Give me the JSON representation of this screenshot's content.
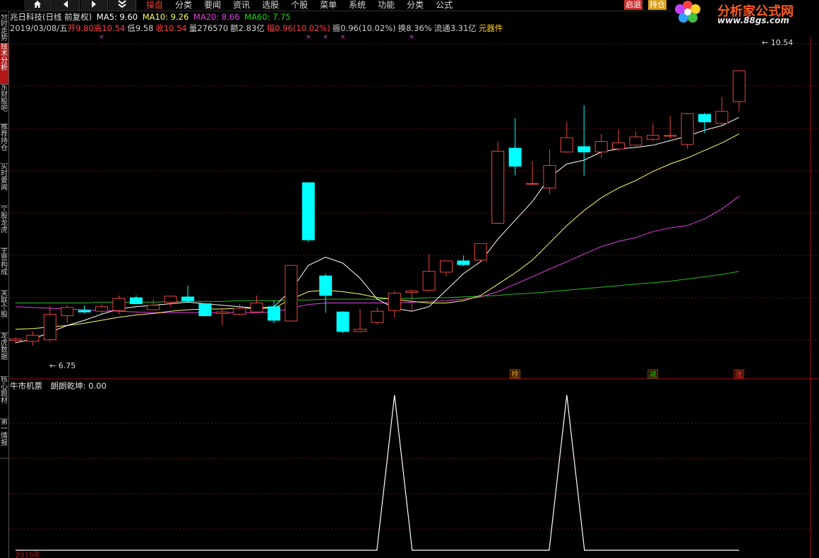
{
  "toolbar": {
    "nav_icons": [
      "home-icon",
      "back-arrow-icon",
      "forward-arrow-icon",
      "double-chevron-down-icon"
    ],
    "menu": [
      "操盘",
      "分类",
      "要闻",
      "资讯",
      "选股",
      "个股",
      "菜单",
      "系统",
      "功能",
      "分类",
      "公式"
    ],
    "active_menu": "操盘",
    "right_buttons": [
      "启退",
      "持仓"
    ]
  },
  "logo": {
    "text": "分析家公式网",
    "url": "www.88gs.com"
  },
  "sidebar": [
    "分时走势",
    "技术分析",
    "东财股吧",
    "推荐持仓",
    "实时要闻",
    "个股龙虎",
    "主营构成",
    "关联个股",
    "龙虎数据",
    "核心题材",
    "第一情报"
  ],
  "sidebar_active": "技术分析",
  "header": {
    "stock": "兆日科技(日线 前复权)",
    "ma5": "MA5: 9.60",
    "ma10": "MA10: 9.26",
    "ma20": "MA20: 8.66",
    "ma60": "MA60: 7.75",
    "date": "2019/03/08/五",
    "open": "开9.80",
    "high": "高10.54",
    "low": "低9.58",
    "close": "收10.54",
    "volume": "量276570",
    "amount": "额2.83亿",
    "change": "幅0.96(10.02%)",
    "amplitude": "振0.96(10.02%)",
    "turnover": "换8.36%",
    "float": "流通3.31亿",
    "sector": "元器件"
  },
  "colors": {
    "up": "#e8453c",
    "down": "#00ffff",
    "ma5": "#ffffff",
    "ma10": "#ffff60",
    "ma20": "#e040e0",
    "ma60": "#20c020",
    "grid": "#6b1010",
    "accent_red": "#ff3333",
    "indicator": "#ffffff"
  },
  "price_labels": {
    "max": "10.54",
    "min": "6.75"
  },
  "badges": [
    {
      "text": "榜",
      "color": "#d4a020",
      "bar": 29
    },
    {
      "text": "减",
      "color": "#20c020",
      "bar": 37
    },
    {
      "text": "涨",
      "color": "#ff3333",
      "bar": 42
    }
  ],
  "indicator_header": {
    "name": "牛市机票",
    "value": "朗朗乾坤: 0.00"
  },
  "bottom_axis": {
    "left": "2019年"
  },
  "chart_data": {
    "type": "candlestick",
    "price_range": [
      6.6,
      10.9
    ],
    "candles": [
      {
        "o": 6.95,
        "h": 6.99,
        "l": 6.91,
        "c": 6.97
      },
      {
        "o": 6.94,
        "h": 7.07,
        "l": 6.88,
        "c": 7.02
      },
      {
        "o": 6.96,
        "h": 7.41,
        "l": 6.94,
        "c": 7.3
      },
      {
        "o": 7.28,
        "h": 7.42,
        "l": 7.18,
        "c": 7.39
      },
      {
        "o": 7.35,
        "h": 7.42,
        "l": 7.31,
        "c": 7.33
      },
      {
        "o": 7.34,
        "h": 7.43,
        "l": 7.31,
        "c": 7.4
      },
      {
        "o": 7.35,
        "h": 7.55,
        "l": 7.3,
        "c": 7.51
      },
      {
        "o": 7.52,
        "h": 7.55,
        "l": 7.43,
        "c": 7.44
      },
      {
        "o": 7.36,
        "h": 7.5,
        "l": 7.35,
        "c": 7.42
      },
      {
        "o": 7.46,
        "h": 7.55,
        "l": 7.4,
        "c": 7.54
      },
      {
        "o": 7.53,
        "h": 7.68,
        "l": 7.45,
        "c": 7.48
      },
      {
        "o": 7.44,
        "h": 7.45,
        "l": 7.27,
        "c": 7.28
      },
      {
        "o": 7.31,
        "h": 7.38,
        "l": 7.15,
        "c": 7.33
      },
      {
        "o": 7.3,
        "h": 7.44,
        "l": 7.29,
        "c": 7.38
      },
      {
        "o": 7.33,
        "h": 7.55,
        "l": 7.33,
        "c": 7.45
      },
      {
        "o": 7.4,
        "h": 7.48,
        "l": 7.18,
        "c": 7.22
      },
      {
        "o": 7.21,
        "h": 7.95,
        "l": 7.2,
        "c": 7.95
      },
      {
        "o": 9.05,
        "h": 9.05,
        "l": 8.26,
        "c": 8.29
      },
      {
        "o": 7.81,
        "h": 7.84,
        "l": 7.32,
        "c": 7.55
      },
      {
        "o": 7.33,
        "h": 7.34,
        "l": 7.05,
        "c": 7.07
      },
      {
        "o": 7.07,
        "h": 7.37,
        "l": 7.06,
        "c": 7.1
      },
      {
        "o": 7.19,
        "h": 7.39,
        "l": 7.16,
        "c": 7.34
      },
      {
        "o": 7.35,
        "h": 7.61,
        "l": 7.26,
        "c": 7.58
      },
      {
        "o": 7.59,
        "h": 7.63,
        "l": 7.33,
        "c": 7.61
      },
      {
        "o": 7.62,
        "h": 8.1,
        "l": 7.6,
        "c": 7.87
      },
      {
        "o": 7.86,
        "h": 8.02,
        "l": 7.81,
        "c": 8.01
      },
      {
        "o": 8.01,
        "h": 8.08,
        "l": 7.94,
        "c": 7.96
      },
      {
        "o": 8.02,
        "h": 8.24,
        "l": 8.0,
        "c": 8.24
      },
      {
        "o": 8.51,
        "h": 9.6,
        "l": 8.5,
        "c": 9.47
      },
      {
        "o": 9.51,
        "h": 9.91,
        "l": 9.15,
        "c": 9.27
      },
      {
        "o": 9.04,
        "h": 9.34,
        "l": 9.02,
        "c": 9.04
      },
      {
        "o": 8.98,
        "h": 9.5,
        "l": 8.9,
        "c": 9.28
      },
      {
        "o": 9.46,
        "h": 9.86,
        "l": 9.45,
        "c": 9.65
      },
      {
        "o": 9.53,
        "h": 10.08,
        "l": 9.14,
        "c": 9.46
      },
      {
        "o": 9.46,
        "h": 9.7,
        "l": 9.38,
        "c": 9.6
      },
      {
        "o": 9.5,
        "h": 9.76,
        "l": 9.47,
        "c": 9.58
      },
      {
        "o": 9.55,
        "h": 9.73,
        "l": 9.52,
        "c": 9.66
      },
      {
        "o": 9.63,
        "h": 9.84,
        "l": 9.6,
        "c": 9.68
      },
      {
        "o": 9.67,
        "h": 9.94,
        "l": 9.64,
        "c": 9.68
      },
      {
        "o": 9.56,
        "h": 9.98,
        "l": 9.5,
        "c": 9.97
      },
      {
        "o": 9.96,
        "h": 9.98,
        "l": 9.71,
        "c": 9.86
      },
      {
        "o": 9.84,
        "h": 10.19,
        "l": 9.82,
        "c": 10.0
      },
      {
        "o": 10.13,
        "h": 10.54,
        "l": 10.0,
        "c": 10.54
      }
    ],
    "ma5": [
      6.92,
      6.97,
      7.06,
      7.15,
      7.22,
      7.3,
      7.37,
      7.4,
      7.42,
      7.44,
      7.46,
      7.44,
      7.42,
      7.4,
      7.38,
      7.4,
      7.62,
      7.95,
      8.06,
      7.98,
      7.78,
      7.5,
      7.38,
      7.34,
      7.4,
      7.62,
      7.84,
      8.0,
      8.3,
      8.55,
      8.8,
      9.12,
      9.3,
      9.35,
      9.46,
      9.5,
      9.52,
      9.55,
      9.61,
      9.67,
      9.75,
      9.81,
      9.92
    ],
    "ma10": [
      7.1,
      7.11,
      7.13,
      7.15,
      7.18,
      7.22,
      7.26,
      7.29,
      7.31,
      7.34,
      7.36,
      7.37,
      7.37,
      7.38,
      7.38,
      7.38,
      7.5,
      7.6,
      7.62,
      7.6,
      7.57,
      7.52,
      7.5,
      7.47,
      7.45,
      7.45,
      7.48,
      7.55,
      7.7,
      7.85,
      8.02,
      8.25,
      8.48,
      8.68,
      8.85,
      8.98,
      9.08,
      9.2,
      9.3,
      9.38,
      9.48,
      9.58,
      9.7
    ],
    "ma20": [
      7.4,
      7.39,
      7.38,
      7.37,
      7.36,
      7.35,
      7.34,
      7.33,
      7.32,
      7.32,
      7.32,
      7.32,
      7.32,
      7.32,
      7.32,
      7.33,
      7.38,
      7.43,
      7.45,
      7.45,
      7.45,
      7.45,
      7.45,
      7.46,
      7.47,
      7.48,
      7.5,
      7.53,
      7.6,
      7.7,
      7.8,
      7.9,
      8.0,
      8.1,
      8.2,
      8.27,
      8.32,
      8.4,
      8.45,
      8.48,
      8.57,
      8.7,
      8.87
    ],
    "ma60": [
      7.45,
      7.45,
      7.45,
      7.45,
      7.45,
      7.46,
      7.46,
      7.46,
      7.46,
      7.47,
      7.47,
      7.47,
      7.47,
      7.48,
      7.48,
      7.48,
      7.49,
      7.49,
      7.5,
      7.5,
      7.5,
      7.5,
      7.51,
      7.51,
      7.52,
      7.52,
      7.53,
      7.54,
      7.55,
      7.57,
      7.58,
      7.6,
      7.62,
      7.64,
      7.66,
      7.68,
      7.7,
      7.72,
      7.74,
      7.77,
      7.8,
      7.83,
      7.87
    ],
    "indicator": {
      "range": [
        0,
        1
      ],
      "signal_bars": [
        22,
        32
      ]
    }
  }
}
